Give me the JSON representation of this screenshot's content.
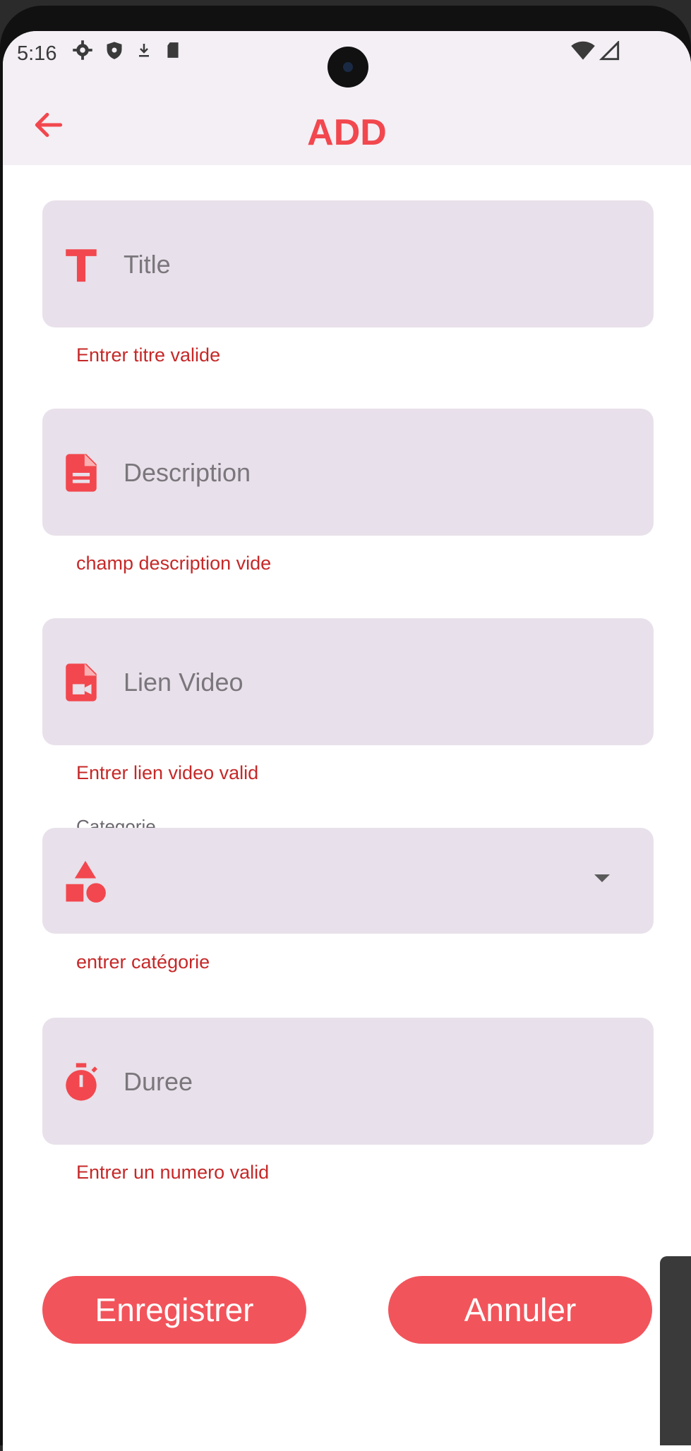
{
  "status_bar": {
    "time": "5:16"
  },
  "app_bar": {
    "title": "ADD"
  },
  "form": {
    "title": {
      "placeholder": "Title",
      "error": "Entrer titre valide"
    },
    "description": {
      "placeholder": "Description",
      "error": "champ description vide"
    },
    "video_link": {
      "placeholder": "Lien Video",
      "error": "Entrer lien video valid"
    },
    "category": {
      "label": "Categorie",
      "error": "entrer catégorie"
    },
    "duration": {
      "placeholder": "Duree",
      "error": "Entrer un numero valid"
    }
  },
  "buttons": {
    "save": "Enregistrer",
    "cancel": "Annuler"
  },
  "colors": {
    "accent": "#f2474e",
    "field_bg": "#e8e0ea",
    "error": "#c62828",
    "button_bg": "#f2545b"
  },
  "icons": [
    "back-arrow-icon",
    "text-icon",
    "document-icon",
    "video-file-icon",
    "category-shapes-icon",
    "timer-icon",
    "dropdown-caret-icon",
    "settings-icon",
    "shield-icon",
    "download-icon",
    "sd-card-icon",
    "wifi-icon",
    "signal-icon"
  ]
}
